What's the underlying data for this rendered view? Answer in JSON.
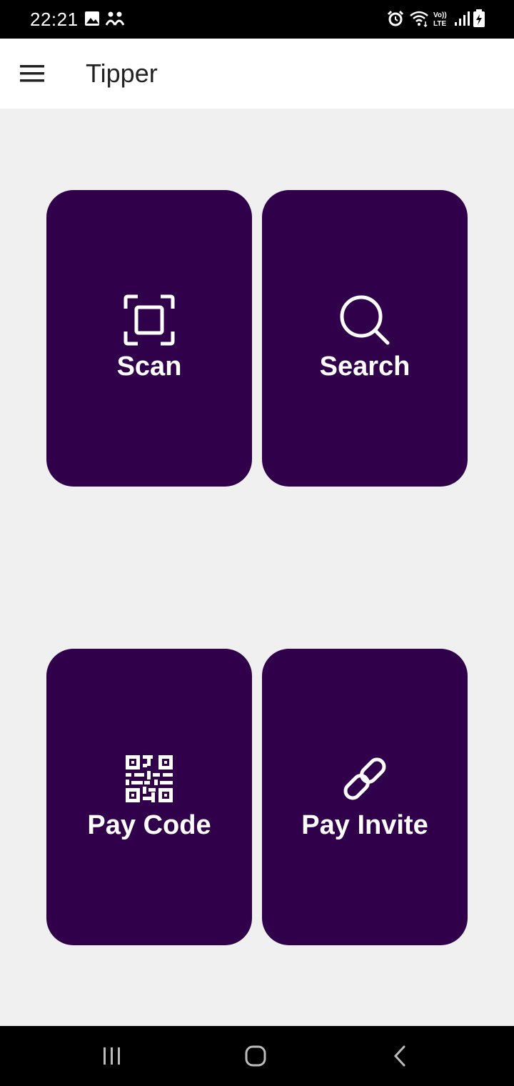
{
  "status_bar": {
    "time": "22:21",
    "icons": [
      "gallery-icon",
      "people-icon",
      "alarm-icon",
      "wifi-icon",
      "volte-lte-icon",
      "signal-icon",
      "battery-charging-icon"
    ]
  },
  "app_bar": {
    "title": "Tipper",
    "menu_icon": "hamburger-menu-icon"
  },
  "tiles": [
    {
      "label": "Scan",
      "icon": "scan-frame-icon"
    },
    {
      "label": "Search",
      "icon": "search-icon"
    },
    {
      "label": "Pay Code",
      "icon": "qr-code-icon"
    },
    {
      "label": "Pay Invite",
      "icon": "link-icon"
    }
  ],
  "colors": {
    "tile_background": "#30004a",
    "page_background": "#f0f0f0",
    "app_bar_background": "#ffffff"
  },
  "nav_bar": {
    "buttons": [
      "recent-apps-icon",
      "home-icon",
      "back-icon"
    ]
  }
}
